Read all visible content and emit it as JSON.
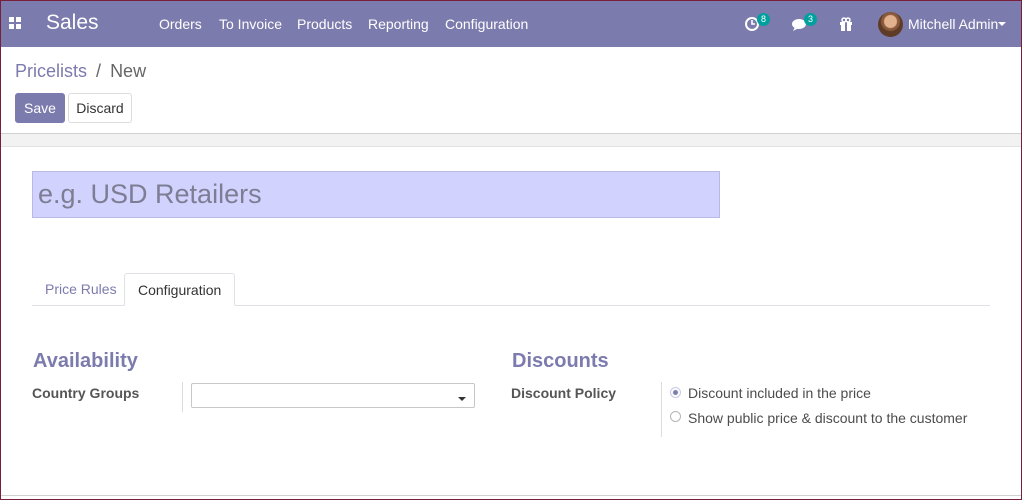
{
  "navbar": {
    "app_name": "Sales",
    "menu": [
      "Orders",
      "To Invoice",
      "Products",
      "Reporting",
      "Configuration"
    ],
    "activity_count": "8",
    "messages_count": "3",
    "user_name": "Mitchell Admin",
    "accent_color": "#7c7bad",
    "badge_color": "#00a09d"
  },
  "breadcrumb": {
    "parent": "Pricelists",
    "separator": "/",
    "current": "New"
  },
  "buttons": {
    "save": "Save",
    "discard": "Discard"
  },
  "form": {
    "name_placeholder": "e.g. USD Retailers",
    "name_value": ""
  },
  "tabs": [
    "Price Rules",
    "Configuration"
  ],
  "active_tab": "Configuration",
  "availability": {
    "title": "Availability",
    "country_groups_label": "Country Groups",
    "country_groups_value": ""
  },
  "discounts": {
    "title": "Discounts",
    "policy_label": "Discount Policy",
    "options": [
      "Discount included in the price",
      "Show public price & discount to the customer"
    ],
    "selected": "Discount included in the price"
  }
}
